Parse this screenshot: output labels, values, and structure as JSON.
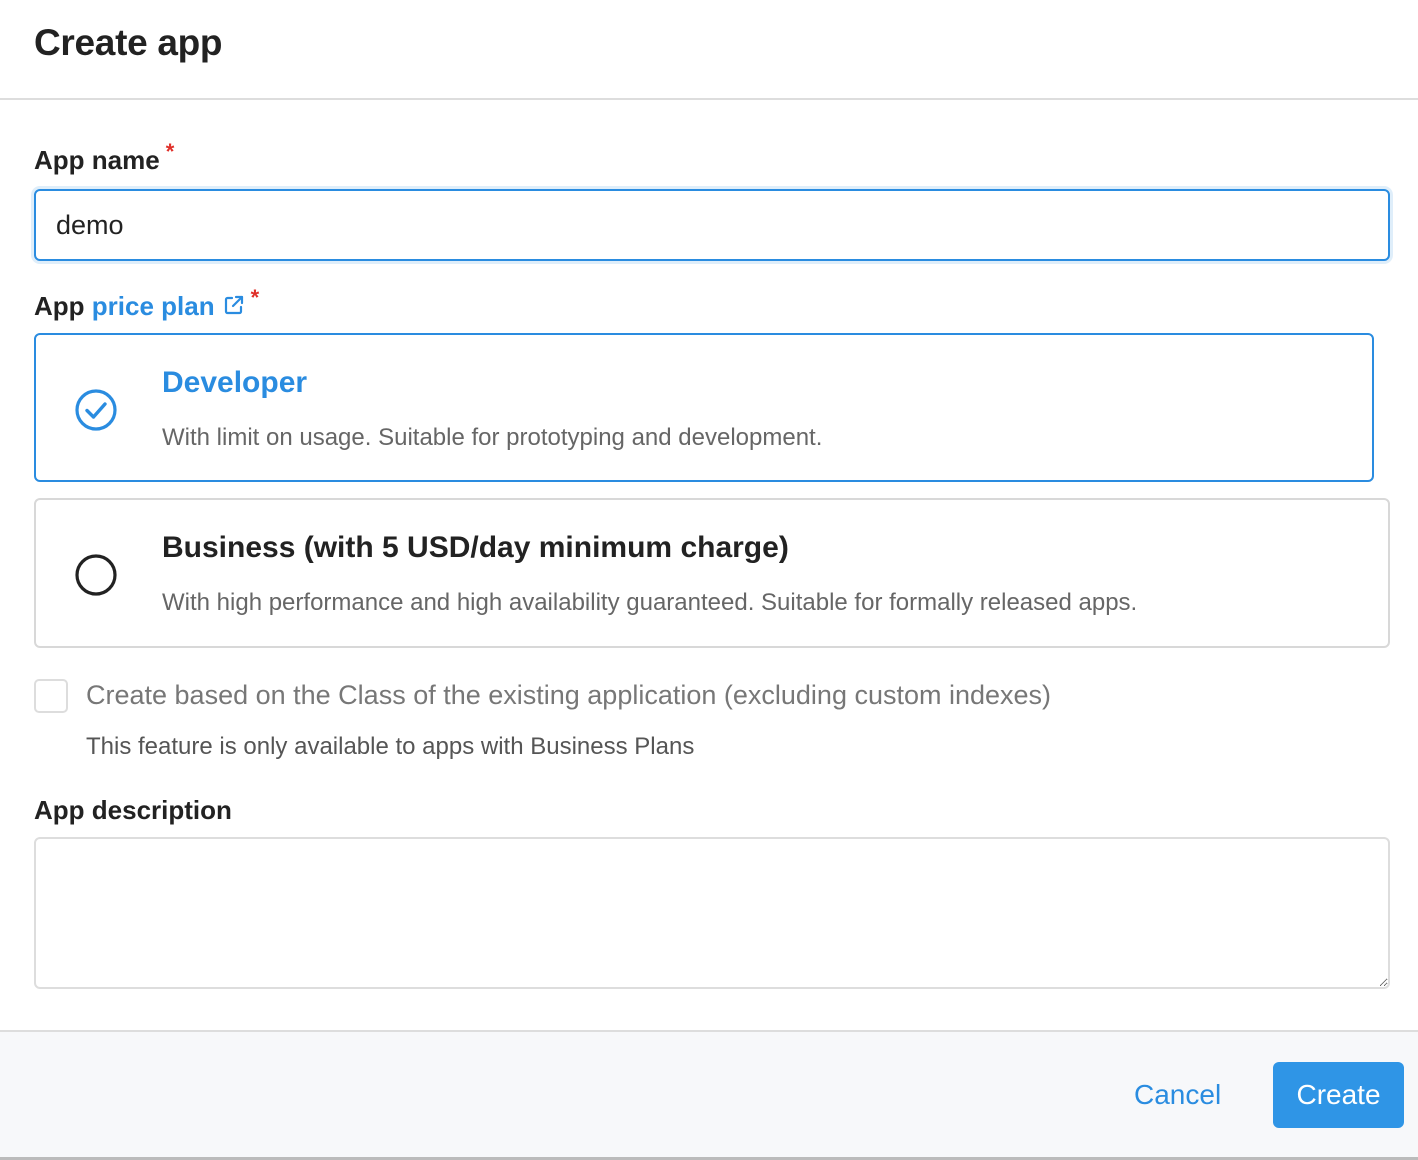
{
  "dialog": {
    "title": "Create app"
  },
  "app_name": {
    "label": "App name",
    "required_mark": "*",
    "value": "demo"
  },
  "price_plan": {
    "label_prefix": "App",
    "link_text": "price plan",
    "link_icon": "external-link-icon",
    "required_mark": "*",
    "options": [
      {
        "title": "Developer",
        "description": "With limit on usage. Suitable for prototyping and development.",
        "selected": true
      },
      {
        "title": "Business (with 5 USD/day minimum charge)",
        "description": "With high performance and high availability guaranteed. Suitable for formally released apps.",
        "selected": false
      }
    ]
  },
  "clone_option": {
    "label": "Create based on the Class of the existing application (excluding custom indexes)",
    "hint": "This feature is only available to apps with Business Plans",
    "checked": false,
    "disabled": true
  },
  "app_description": {
    "label": "App description",
    "value": ""
  },
  "footer": {
    "cancel_label": "Cancel",
    "create_label": "Create"
  },
  "colors": {
    "accent": "#2a8ce0",
    "required": "#e0302a",
    "muted_text": "#666666"
  }
}
